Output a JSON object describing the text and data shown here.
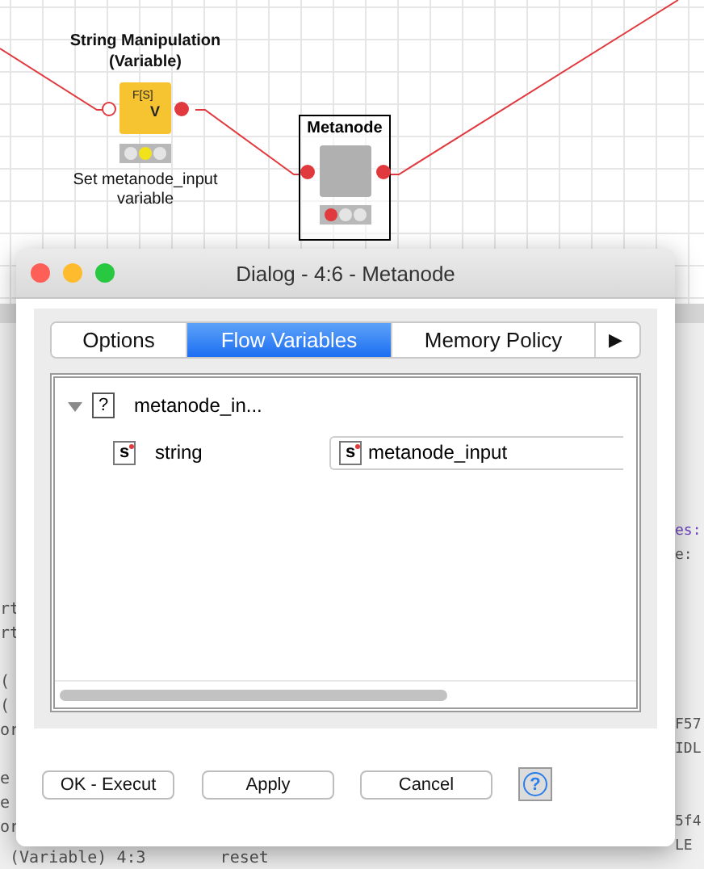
{
  "canvas": {
    "nodes": [
      {
        "kind": "node",
        "title": "String Manipulation (Variable)",
        "icon_top": "F[S]",
        "icon_bottom": "V",
        "caption": "Set metanode_input variable",
        "lights": [
          {
            "lit": false
          },
          {
            "lit": true
          },
          {
            "lit": false
          }
        ]
      },
      {
        "kind": "metanode",
        "title": "Metanode",
        "lights": [
          {
            "lit": true
          },
          {
            "lit": false
          },
          {
            "lit": false
          }
        ]
      }
    ]
  },
  "console": {
    "left_lines": [
      {
        "kind": "blank"
      },
      {
        "kind": "plain",
        "text": "rt"
      },
      {
        "kind": "plain",
        "text": "rt"
      },
      {
        "kind": "blank"
      },
      {
        "kind": "plain",
        "text": "("
      },
      {
        "kind": "plain",
        "text": "("
      },
      {
        "kind": "plain",
        "text": "or"
      },
      {
        "kind": "blank"
      },
      {
        "kind": "plain",
        "text": "e"
      },
      {
        "kind": "plain",
        "text": "e"
      },
      {
        "kind": "plain",
        "text": "or"
      }
    ],
    "bottom_line": [
      "(Variable) 4:3",
      "reset"
    ],
    "right_lines": [
      {
        "text": "es:",
        "kind": "keyword"
      },
      {
        "text": "e:",
        "kind": "plain"
      },
      {
        "kind": "blank"
      },
      {
        "kind": "blank"
      },
      {
        "kind": "blank"
      },
      {
        "kind": "blank"
      },
      {
        "kind": "blank"
      },
      {
        "kind": "blank"
      },
      {
        "text": "F57",
        "kind": "plain"
      },
      {
        "text": "IDL",
        "kind": "plain"
      },
      {
        "kind": "blank"
      },
      {
        "kind": "blank"
      },
      {
        "text": "5f4",
        "kind": "plain"
      },
      {
        "text": "LE",
        "kind": "plain"
      }
    ]
  },
  "dialog": {
    "title": "Dialog - 4:6 - Metanode",
    "tabs": [
      {
        "label": "Options",
        "selected": false
      },
      {
        "label": "Flow Variables",
        "selected": true
      },
      {
        "label": "Memory Policy",
        "selected": false
      }
    ],
    "more_tabs": "▶",
    "tree": [
      {
        "label": "metanode_in...",
        "icon": "?",
        "expanded": true,
        "children": [
          {
            "label": "string",
            "icon": "s",
            "value": "metanode_input",
            "value_icon": "s"
          }
        ]
      }
    ],
    "buttons": [
      "OK - Execut",
      "Apply",
      "Cancel"
    ],
    "help": "?"
  }
}
